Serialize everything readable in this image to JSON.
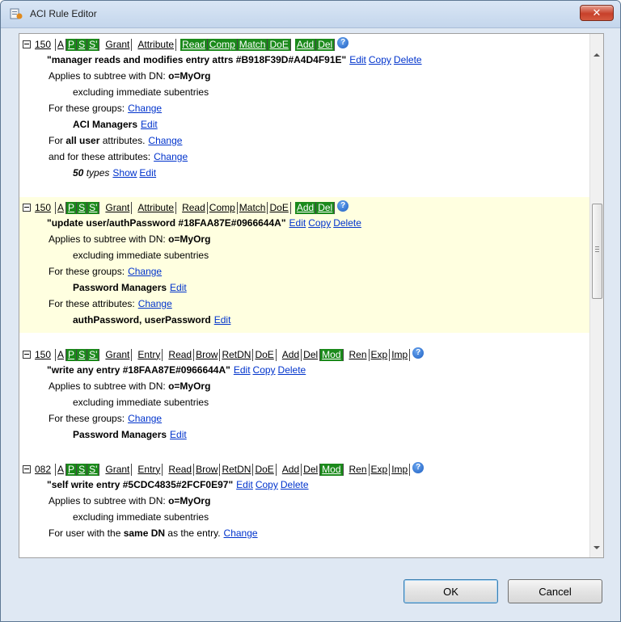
{
  "window": {
    "title": "ACI Rule Editor",
    "close_label": "✕"
  },
  "buttons": {
    "ok": "OK",
    "cancel": "Cancel"
  },
  "rules": [
    {
      "priority": "150",
      "scope": [
        "A",
        "P",
        "S",
        "S'"
      ],
      "scope_on": [
        false,
        true,
        true,
        true
      ],
      "grant": "Grant",
      "target": "Attribute",
      "perms": [
        "Read",
        "Comp",
        "Match",
        "DoE",
        "Add",
        "Del"
      ],
      "perms_on": [
        true,
        true,
        true,
        true,
        true,
        true
      ],
      "title": "\"manager reads and modifies entry attrs #B918F39D#A4D4F91E\"",
      "subtree_label": "Applies to subtree with DN:",
      "subtree_dn": "o=MyOrg",
      "excluding": "excluding immediate subentries",
      "groups_label": "For these groups:",
      "groups_value": "ACI Managers",
      "attr_line1_prefix": "For ",
      "attr_line1_bold": "all user",
      "attr_line1_suffix": " attributes.",
      "attr_line2": "and for these attributes:",
      "types_count": "50",
      "types_label": "types",
      "show_label": "Show"
    },
    {
      "priority": "150",
      "scope": [
        "A",
        "P",
        "S",
        "S'"
      ],
      "scope_on": [
        false,
        true,
        true,
        true
      ],
      "grant": "Grant",
      "target": "Attribute",
      "perms": [
        "Read",
        "Comp",
        "Match",
        "DoE",
        "Add",
        "Del"
      ],
      "perms_on": [
        false,
        false,
        false,
        false,
        true,
        true
      ],
      "title": "\"update user/authPassword #18FAA87E#0966644A\"",
      "subtree_label": "Applies to subtree with DN:",
      "subtree_dn": "o=MyOrg",
      "excluding": "excluding immediate subentries",
      "groups_label": "For these groups:",
      "groups_value": "Password Managers",
      "attrs_label": "For these attributes:",
      "attrs_value": "authPassword, userPassword"
    },
    {
      "priority": "150",
      "scope": [
        "A",
        "P",
        "S",
        "S'"
      ],
      "scope_on": [
        false,
        true,
        true,
        true
      ],
      "grant": "Grant",
      "target": "Entry",
      "perms": [
        "Read",
        "Brow",
        "RetDN",
        "DoE",
        "Add",
        "Del",
        "Mod",
        "Ren",
        "Exp",
        "Imp"
      ],
      "perms_on": [
        false,
        false,
        false,
        false,
        false,
        false,
        true,
        false,
        false,
        false
      ],
      "title": "\"write any entry #18FAA87E#0966644A\"",
      "subtree_label": "Applies to subtree with DN:",
      "subtree_dn": "o=MyOrg",
      "excluding": "excluding immediate subentries",
      "groups_label": "For these groups:",
      "groups_value": "Password Managers"
    },
    {
      "priority": "082",
      "scope": [
        "A",
        "P",
        "S",
        "S'"
      ],
      "scope_on": [
        false,
        true,
        true,
        true
      ],
      "grant": "Grant",
      "target": "Entry",
      "perms": [
        "Read",
        "Brow",
        "RetDN",
        "DoE",
        "Add",
        "Del",
        "Mod",
        "Ren",
        "Exp",
        "Imp"
      ],
      "perms_on": [
        false,
        false,
        false,
        false,
        false,
        false,
        true,
        false,
        false,
        false
      ],
      "title": "\"self write entry #5CDC4835#2FCF0E97\"",
      "subtree_label": "Applies to subtree with DN:",
      "subtree_dn": "o=MyOrg",
      "excluding": "excluding immediate subentries",
      "user_prefix": "For user with the ",
      "user_bold": "same DN",
      "user_suffix": " as the entry."
    }
  ],
  "links": {
    "edit": "Edit",
    "copy": "Copy",
    "delete": "Delete",
    "change": "Change"
  },
  "help_glyph": "?",
  "colors": {
    "on": "#1b8a1b",
    "highlight": "#ffffe0",
    "link": "#0033cc"
  }
}
